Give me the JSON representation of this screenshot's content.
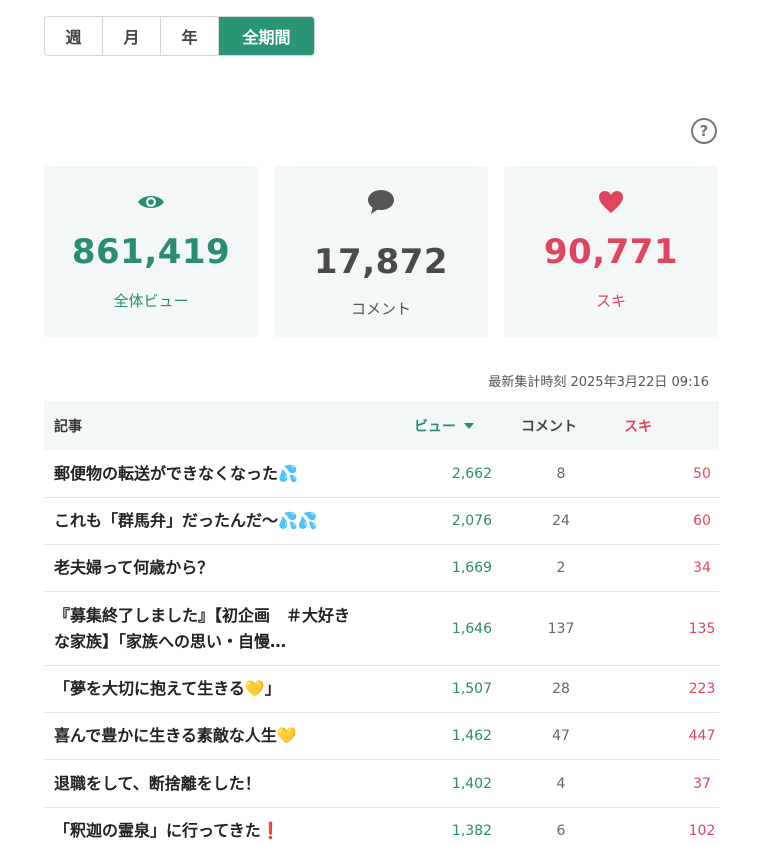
{
  "period_tabs": [
    {
      "label": "週",
      "active": false
    },
    {
      "label": "月",
      "active": false
    },
    {
      "label": "年",
      "active": false
    },
    {
      "label": "全期間",
      "active": true
    }
  ],
  "help_icon": "question-circle-icon",
  "stats": {
    "views": {
      "icon": "eye-icon",
      "value": "861,419",
      "label": "全体ビュー"
    },
    "comments": {
      "icon": "speech-bubble-icon",
      "value": "17,872",
      "label": "コメント"
    },
    "likes": {
      "icon": "heart-icon",
      "value": "90,771",
      "label": "スキ"
    }
  },
  "updated_text": "最新集計時刻 2025年3月22日 09:16",
  "table": {
    "headers": {
      "article": "記事",
      "views": "ビュー",
      "comments": "コメント",
      "likes": "スキ"
    },
    "rows": [
      {
        "title": "郵便物の転送ができなくなった💦",
        "views": "2,662",
        "comments": "8",
        "likes": "50"
      },
      {
        "title": "これも「群馬弁」だったんだ〜💦💦",
        "views": "2,076",
        "comments": "24",
        "likes": "60"
      },
      {
        "title": "老夫婦って何歳から？",
        "views": "1,669",
        "comments": "2",
        "likes": "34"
      },
      {
        "title": "『募集終了しました』【初企画　＃大好きな家族】「家族への思い・自慢…",
        "views": "1,646",
        "comments": "137",
        "likes": "135"
      },
      {
        "title": "「夢を大切に抱えて生きる💛」",
        "views": "1,507",
        "comments": "28",
        "likes": "223"
      },
      {
        "title": "喜んで豊かに生きる素敵な人生💛",
        "views": "1,462",
        "comments": "47",
        "likes": "447"
      },
      {
        "title": "退職をして、断捨離をした！",
        "views": "1,402",
        "comments": "4",
        "likes": "37"
      },
      {
        "title": "「釈迦の霊泉」に行ってきた❗",
        "views": "1,382",
        "comments": "6",
        "likes": "102"
      }
    ]
  },
  "colors": {
    "accent_green": "#2a9477",
    "like_red": "#e0455f",
    "card_bg": "#f4f7f7"
  }
}
